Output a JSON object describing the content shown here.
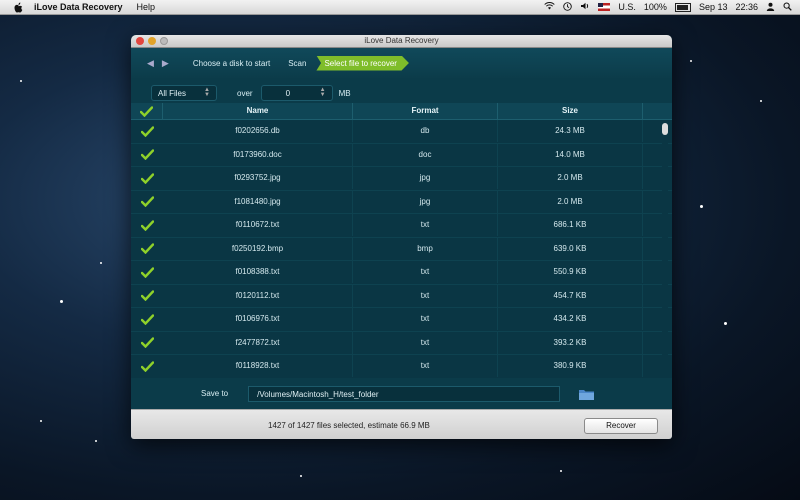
{
  "menubar": {
    "app_name": "iLove Data Recovery",
    "menus": [
      "Help"
    ],
    "locale": "U.S.",
    "battery": "100%",
    "date": "Sep 13",
    "time": "22:36"
  },
  "window": {
    "title": "iLove Data Recovery"
  },
  "toolbar": {
    "steps": [
      "Choose a disk to start",
      "Scan",
      "Select file to recover"
    ],
    "active_step": 2
  },
  "filter": {
    "type_value": "All Files",
    "over_label": "over",
    "size_value": "0",
    "unit_label": "MB"
  },
  "table": {
    "columns": [
      "Name",
      "Format",
      "Size"
    ],
    "rows": [
      {
        "name": "f0202656.db",
        "format": "db",
        "size": "24.3 MB"
      },
      {
        "name": "f0173960.doc",
        "format": "doc",
        "size": "14.0 MB"
      },
      {
        "name": "f0293752.jpg",
        "format": "jpg",
        "size": "2.0 MB"
      },
      {
        "name": "f1081480.jpg",
        "format": "jpg",
        "size": "2.0 MB"
      },
      {
        "name": "f0110672.txt",
        "format": "txt",
        "size": "686.1 KB"
      },
      {
        "name": "f0250192.bmp",
        "format": "bmp",
        "size": "639.0 KB"
      },
      {
        "name": "f0108388.txt",
        "format": "txt",
        "size": "550.9 KB"
      },
      {
        "name": "f0120112.txt",
        "format": "txt",
        "size": "454.7 KB"
      },
      {
        "name": "f0106976.txt",
        "format": "txt",
        "size": "434.2 KB"
      },
      {
        "name": "f2477872.txt",
        "format": "txt",
        "size": "393.2 KB"
      },
      {
        "name": "f0118928.txt",
        "format": "txt",
        "size": "380.9 KB"
      }
    ]
  },
  "save": {
    "label": "Save to",
    "path": "/Volumes/Macintosh_H/test_folder"
  },
  "status": {
    "text": "1427 of 1427 files selected, estimate 66.9 MB",
    "recover_label": "Recover"
  },
  "colors": {
    "accent": "#7fbd2a",
    "panel": "#0b3b49",
    "check": "#8fd12a"
  }
}
